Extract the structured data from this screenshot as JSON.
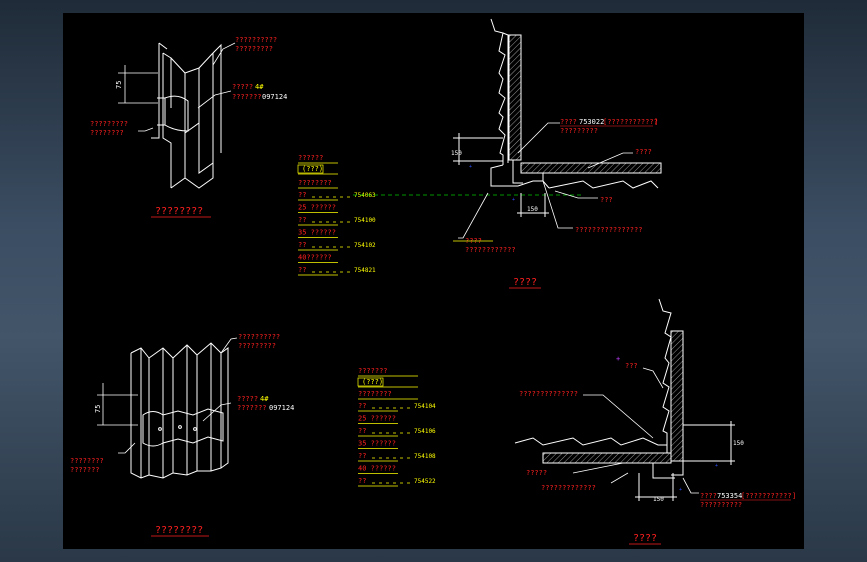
{
  "colors": {
    "background": "#000000",
    "line": "#ffffff",
    "label_red": "#ff2020",
    "label_yellow": "#ffff00",
    "guide_green": "#00c800",
    "dim_blue": "#3050ff",
    "frame": "#3a4b5e"
  },
  "views": {
    "tl": {
      "title": "????????",
      "leader_top": [
        "??????????",
        "?????????"
      ],
      "leader_mid": [
        "?????",
        "4#",
        "???????",
        "097124"
      ],
      "leader_left": [
        "?????????",
        "????????"
      ],
      "dim": "75"
    },
    "bl": {
      "title": "????????",
      "leader_top": [
        "??????????",
        "?????????"
      ],
      "leader_mid": [
        "?????",
        "4#",
        "???????",
        "097124"
      ],
      "leader_left": [
        "????????",
        "???????"
      ],
      "dim": "75"
    },
    "tr": {
      "title": "????",
      "dim_vertical": "150",
      "dim_horizontal": "150",
      "callout_top": [
        "????",
        "753022",
        "[????????????",
        "]",
        "?????????"
      ],
      "callout_right_upper": "????",
      "callout_right_lower": "???",
      "callout_bottom": "????????????????",
      "callout_left": [
        "????",
        "????????????"
      ]
    },
    "br": {
      "title": "????",
      "dim_vertical": "150",
      "dim_horizontal": "150",
      "callout_top": "???",
      "callout_left": "??????????????",
      "callout_left_lower": "?????",
      "callout_bottom_left": "?????????????",
      "callout_bottom_right": [
        "????",
        "753354",
        "[???????????",
        "]",
        "??????????"
      ]
    }
  },
  "legends": {
    "upper": {
      "title": "??????",
      "tag": "(???)",
      "subtitle": "????????",
      "rows": [
        {
          "a": "??",
          "b": "754063"
        },
        {
          "a": "25 ??????",
          "b": ""
        },
        {
          "a": "??",
          "b": "754100"
        },
        {
          "a": "35 ??????",
          "b": ""
        },
        {
          "a": "??",
          "b": "754102"
        },
        {
          "a": "40??????",
          "b": ""
        },
        {
          "a": "??",
          "b": "754821"
        }
      ]
    },
    "lower": {
      "title": "???????",
      "tag": "(???)",
      "subtitle": "????????",
      "rows": [
        {
          "a": "??",
          "b": "754104"
        },
        {
          "a": "25 ??????",
          "b": ""
        },
        {
          "a": "??",
          "b": "754106"
        },
        {
          "a": "35 ??????",
          "b": ""
        },
        {
          "a": "??",
          "b": "754108"
        },
        {
          "a": "40 ??????",
          "b": ""
        },
        {
          "a": "??",
          "b": "754522"
        }
      ]
    }
  }
}
